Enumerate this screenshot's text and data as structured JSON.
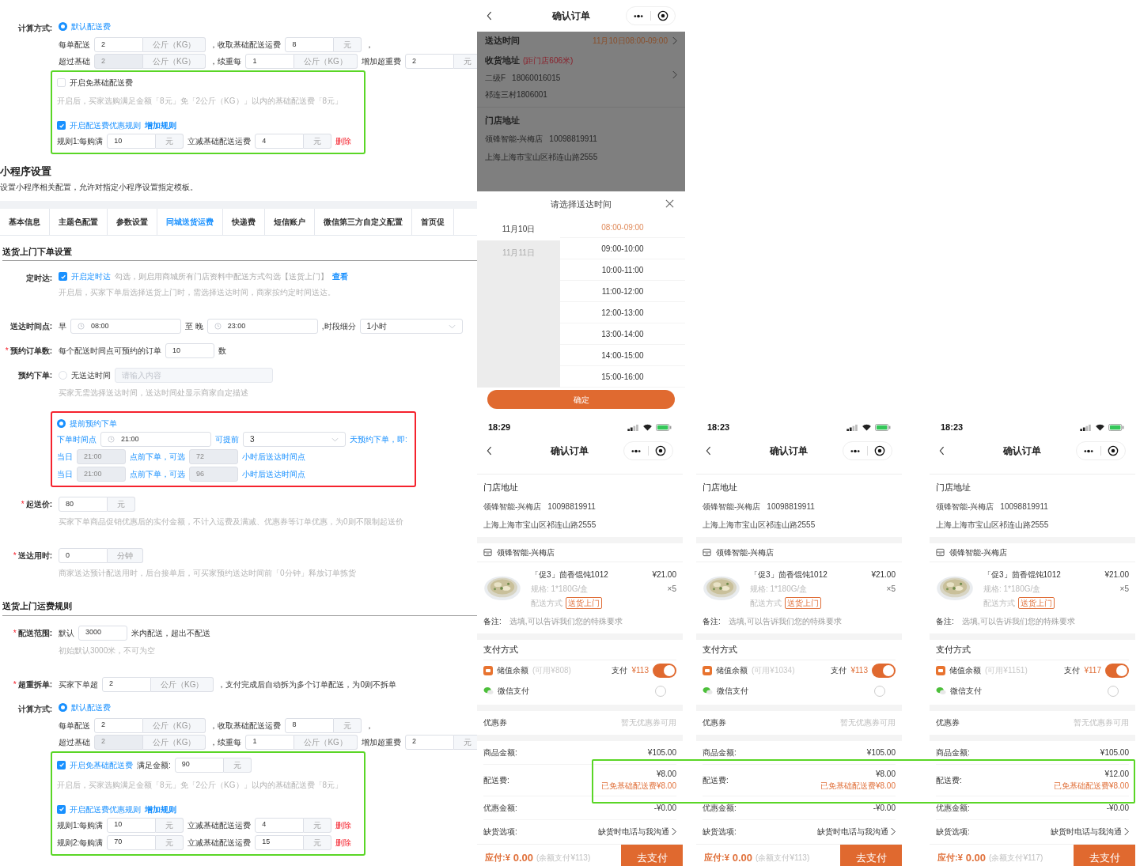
{
  "admin": {
    "blocks": [
      {
        "kind": "row",
        "label": "计算方式:",
        "parts": [
          {
            "kind": "radio",
            "label": "默认配送费",
            "selected": true
          }
        ]
      },
      {
        "kind": "subrow",
        "parts": [
          {
            "kind": "text",
            "text": "每单配送"
          },
          {
            "kind": "input",
            "value": "2",
            "addon": "公斤（KG）",
            "disabled": false
          },
          {
            "kind": "text",
            "text": "，收取基础配送运费"
          },
          {
            "kind": "input",
            "value": "8",
            "addon": "元",
            "disabled": false
          },
          {
            "kind": "text",
            "text": "，"
          }
        ]
      },
      {
        "kind": "subrow",
        "parts": [
          {
            "kind": "text",
            "text": "超过基础"
          },
          {
            "kind": "input",
            "value": "2",
            "addon": "公斤（KG）",
            "disabled": true
          },
          {
            "kind": "text",
            "text": "，续重每"
          },
          {
            "kind": "input",
            "value": "1",
            "addon": "公斤（KG）",
            "disabled": false
          },
          {
            "kind": "text",
            "text": "增加超重费"
          },
          {
            "kind": "input",
            "value": "2",
            "addon": "元",
            "disabled": false
          }
        ]
      },
      {
        "kind": "frame",
        "color": "#5ad626",
        "rows": [
          {
            "kind": "subrow",
            "parts": [
              {
                "kind": "checkbox",
                "label": "开启免基础配送费",
                "checked": false
              }
            ]
          },
          {
            "kind": "hint",
            "text": "开启后，买家选购满足金额「8元」免「2公斤（KG）」以内的基础配送费「8元」"
          },
          {
            "kind": "subrow",
            "parts": [
              {
                "kind": "checkbox",
                "label": "开启配送费优惠规则",
                "checked": true
              },
              {
                "kind": "link",
                "text": "增加规则"
              }
            ]
          },
          {
            "kind": "subrow",
            "parts": [
              {
                "kind": "text",
                "text": "规则1:每购满"
              },
              {
                "kind": "input",
                "value": "10",
                "addon": "元",
                "disabled": false
              },
              {
                "kind": "text",
                "text": "立减基础配送运费"
              },
              {
                "kind": "input",
                "value": "4",
                "addon": "元",
                "disabled": false
              },
              {
                "kind": "danger",
                "text": "删除"
              }
            ]
          }
        ]
      },
      {
        "kind": "page_title",
        "text": "小程序设置"
      },
      {
        "kind": "subtitle",
        "text": "设置小程序相关配置，允许对指定小程序设置指定模板。"
      },
      {
        "kind": "tabs",
        "tabs": [
          {
            "label": "基本信息",
            "selected": false
          },
          {
            "label": "主题色配置",
            "selected": false
          },
          {
            "label": "参数设置",
            "selected": false
          },
          {
            "label": "同城送货运费",
            "selected": true
          },
          {
            "label": "快递费",
            "selected": false
          },
          {
            "label": "短信账户",
            "selected": false
          },
          {
            "label": "微信第三方自定义配置",
            "selected": false
          },
          {
            "label": "首页促",
            "selected": false
          }
        ]
      },
      {
        "kind": "section",
        "text": "送货上门下单设置"
      },
      {
        "kind": "row",
        "label": "定时达:",
        "parts": [
          {
            "kind": "checkbox",
            "label": "开启定时达",
            "checked": true
          },
          {
            "kind": "muted",
            "text": "勾选，则启用商城所有门店资料中配送方式勾选【送货上门】"
          },
          {
            "kind": "link",
            "text": "查看"
          }
        ],
        "hint": "开启后，买家下单后选择送货上门时，需选择送达时间，商家按约定时间送达。"
      },
      {
        "kind": "row",
        "label": "送达时间点:",
        "parts": [
          {
            "kind": "text",
            "text": "早"
          },
          {
            "kind": "time",
            "value": "08:00"
          },
          {
            "kind": "text",
            "text": "至 晚"
          },
          {
            "kind": "time",
            "value": "23:00"
          },
          {
            "kind": "text",
            "text": ",时段细分"
          },
          {
            "kind": "select",
            "value": "1小时"
          }
        ]
      },
      {
        "kind": "row",
        "required_mark": "*",
        "label": "预约订单数:",
        "parts": [
          {
            "kind": "text",
            "text": "每个配送时间点可预约的订单"
          },
          {
            "kind": "input",
            "value": "10",
            "disabled": false
          },
          {
            "kind": "text",
            "text": "数"
          }
        ]
      },
      {
        "kind": "row",
        "label": "预约下单:",
        "parts": [
          {
            "kind": "radio",
            "label": "无送达时间",
            "selected": false
          },
          {
            "kind": "placeholder_input",
            "placeholder": "请输入内容"
          }
        ],
        "hint": "买家无需选择送达时间，送达时间处显示商家自定描述"
      },
      {
        "kind": "frame",
        "color": "#f5222d",
        "rows": [
          {
            "kind": "subrow",
            "parts": [
              {
                "kind": "radio",
                "label": "提前预约下单",
                "selected": true
              }
            ]
          },
          {
            "kind": "subrow",
            "parts": [
              {
                "kind": "accent",
                "text": "下单时间点"
              },
              {
                "kind": "time",
                "value": "21:00"
              },
              {
                "kind": "accent",
                "text": "可提前"
              },
              {
                "kind": "select",
                "value": "3"
              },
              {
                "kind": "accent",
                "text": "天预约下单，即:"
              }
            ]
          },
          {
            "kind": "subrow",
            "parts": [
              {
                "kind": "accent",
                "text": "当日"
              },
              {
                "kind": "input",
                "value": "21:00",
                "disabled": true
              },
              {
                "kind": "accent",
                "text": "点前下单，可选"
              },
              {
                "kind": "input",
                "value": "72",
                "disabled": true
              },
              {
                "kind": "accent",
                "text": "小时后送达时间点"
              }
            ]
          },
          {
            "kind": "subrow",
            "parts": [
              {
                "kind": "accent",
                "text": "当日"
              },
              {
                "kind": "input",
                "value": "21:00",
                "disabled": true
              },
              {
                "kind": "accent",
                "text": "点前下单，可选"
              },
              {
                "kind": "input",
                "value": "96",
                "disabled": true
              },
              {
                "kind": "accent",
                "text": "小时后送达时间点"
              }
            ]
          }
        ]
      },
      {
        "kind": "row",
        "required_mark": "*",
        "label": "起送价:",
        "parts": [
          {
            "kind": "input",
            "value": "80",
            "addon": "元",
            "disabled": false
          }
        ],
        "hint": "买家下单商品促销优惠后的实付金额，不计入运费及满减、优惠券等订单优惠，为0则不限制起送价"
      },
      {
        "kind": "row",
        "required_mark": "*",
        "label": "送达用时:",
        "parts": [
          {
            "kind": "input",
            "value": "0",
            "addon": "分钟",
            "disabled": false
          }
        ],
        "hint": "商家送达预计配送用时，后台接单后，可买家预约送达时间前「0分钟」释放订单拣货"
      },
      {
        "kind": "section",
        "text": "送货上门运费规则"
      },
      {
        "kind": "row",
        "required_mark": "*",
        "label": "配送范围:",
        "parts": [
          {
            "kind": "text",
            "text": "默认"
          },
          {
            "kind": "input",
            "value": "3000",
            "disabled": false
          },
          {
            "kind": "text",
            "text": "米内配送，超出不配送"
          }
        ],
        "hint": "初始默认3000米，不可为空"
      },
      {
        "kind": "row",
        "required_mark": "*",
        "label": "超重拆单:",
        "parts": [
          {
            "kind": "text",
            "text": "买家下单超"
          },
          {
            "kind": "input",
            "value": "2",
            "addon": "公斤（KG）",
            "disabled": false
          },
          {
            "kind": "text",
            "text": "，支付完成后自动拆为多个订单配送，为0则不拆单"
          }
        ]
      },
      {
        "kind": "row",
        "label": "计算方式:",
        "parts": [
          {
            "kind": "radio",
            "label": "默认配送费",
            "selected": true
          }
        ]
      },
      {
        "kind": "subrow",
        "parts": [
          {
            "kind": "text",
            "text": "每单配送"
          },
          {
            "kind": "input",
            "value": "2",
            "addon": "公斤（KG）",
            "disabled": false
          },
          {
            "kind": "text",
            "text": "，收取基础配送运费"
          },
          {
            "kind": "input",
            "value": "8",
            "addon": "元",
            "disabled": false
          },
          {
            "kind": "text",
            "text": "，"
          }
        ]
      },
      {
        "kind": "subrow",
        "parts": [
          {
            "kind": "text",
            "text": "超过基础"
          },
          {
            "kind": "input",
            "value": "2",
            "addon": "公斤（KG）",
            "disabled": true
          },
          {
            "kind": "text",
            "text": "，续重每"
          },
          {
            "kind": "input",
            "value": "1",
            "addon": "公斤（KG）",
            "disabled": false
          },
          {
            "kind": "text",
            "text": "增加超重费"
          },
          {
            "kind": "input",
            "value": "2",
            "addon": "元",
            "disabled": false
          }
        ]
      },
      {
        "kind": "frame",
        "color": "#5ad626",
        "rows": [
          {
            "kind": "subrow",
            "parts": [
              {
                "kind": "checkbox",
                "label": "开启免基础配送费",
                "checked": true
              },
              {
                "kind": "text",
                "text": "满足金额:"
              },
              {
                "kind": "input",
                "value": "90",
                "addon": "元",
                "disabled": false
              }
            ]
          },
          {
            "kind": "hint",
            "text": "开启后，买家选购满足金额「8元」免「2公斤（KG）」以内的基础配送费「8元」"
          },
          {
            "kind": "subrow",
            "parts": [
              {
                "kind": "checkbox",
                "label": "开启配送费优惠规则",
                "checked": true
              },
              {
                "kind": "link",
                "text": "增加规则"
              }
            ]
          },
          {
            "kind": "subrow",
            "parts": [
              {
                "kind": "text",
                "text": "规则1:每购满"
              },
              {
                "kind": "input",
                "value": "10",
                "addon": "元",
                "disabled": false
              },
              {
                "kind": "text",
                "text": "立减基础配送运费"
              },
              {
                "kind": "input",
                "value": "4",
                "addon": "元",
                "disabled": false
              },
              {
                "kind": "danger",
                "text": "删除"
              }
            ]
          },
          {
            "kind": "subrow",
            "parts": [
              {
                "kind": "text",
                "text": "规则2:每购满"
              },
              {
                "kind": "input",
                "value": "70",
                "addon": "元",
                "disabled": false
              },
              {
                "kind": "text",
                "text": "立减基础配送运费"
              },
              {
                "kind": "input",
                "value": "15",
                "addon": "元",
                "disabled": false
              },
              {
                "kind": "danger",
                "text": "删除"
              }
            ]
          }
        ]
      }
    ]
  },
  "modal_phone": {
    "title": "确认订单",
    "delivery_label": "送达时间",
    "delivery_value": "11月10日08:00-09:00",
    "address_label": "收货地址",
    "address_distance": "(距门店606米)",
    "address_name": "二级F",
    "address_phone": "18060016015",
    "address_line": "祁连三村1806001",
    "store_label": "门店地址",
    "store_name": "领锋智能-兴梅店",
    "store_phone": "10098819911",
    "store_address": "上海上海市宝山区祁连山路2555",
    "sheet": {
      "title": "请选择送达时间",
      "dates": [
        {
          "label": "11月10日",
          "selected": true
        },
        {
          "label": "11月11日",
          "selected": false
        }
      ],
      "slots": [
        {
          "label": "08:00-09:00",
          "selected": true
        },
        {
          "label": "09:00-10:00",
          "selected": false
        },
        {
          "label": "10:00-11:00",
          "selected": false
        },
        {
          "label": "11:00-12:00",
          "selected": false
        },
        {
          "label": "12:00-13:00",
          "selected": false
        },
        {
          "label": "13:00-14:00",
          "selected": false
        },
        {
          "label": "14:00-15:00",
          "selected": false
        },
        {
          "label": "15:00-16:00",
          "selected": false
        }
      ],
      "confirm": "确定"
    }
  },
  "order_phones": [
    {
      "time": "18:29",
      "title": "确认订单",
      "store_label": "门店地址",
      "store_name": "领锋智能-兴梅店",
      "store_phone": "10098819911",
      "store_address": "上海上海市宝山区祁连山路2555",
      "shop_name": "领锋智能-兴梅店",
      "product": {
        "name": "「促3」茴香馄饨1012",
        "price": "¥21.00",
        "spec": "规格: 1*180G/盒",
        "qty": "×5",
        "delivery_label": "配送方式",
        "delivery_tag": "送货上门"
      },
      "remark_label": "备注:",
      "remark_placeholder": "选填,可以告诉我们您的特殊要求",
      "payment_label": "支付方式",
      "methods": [
        {
          "kind": "balance",
          "label": "储值余额",
          "available": "(可用¥808)",
          "pay_label": "支付",
          "pay_amount": "¥113",
          "on": true
        },
        {
          "kind": "wechat",
          "label": "微信支付",
          "selected": false
        }
      ],
      "coupon_label": "优惠券",
      "coupon_value": "暂无优惠券可用",
      "summary": [
        {
          "label": "商品金额:",
          "value": "¥105.00"
        },
        {
          "label": "配送费:",
          "value": "¥8.00",
          "note": "已免基础配送费¥8.00"
        },
        {
          "label": "优惠金额:",
          "value": "-¥0.00"
        }
      ],
      "stock_label": "缺货选项:",
      "stock_value": "缺货时电话与我沟通",
      "due_label": "应付:¥",
      "due_amount": "0.00",
      "due_note": "(余额支付¥113)",
      "pay_button": "去支付"
    },
    {
      "time": "18:23",
      "title": "确认订单",
      "store_label": "门店地址",
      "store_name": "领锋智能-兴梅店",
      "store_phone": "10098819911",
      "store_address": "上海上海市宝山区祁连山路2555",
      "shop_name": "领锋智能-兴梅店",
      "product": {
        "name": "「促3」茴香馄饨1012",
        "price": "¥21.00",
        "spec": "规格: 1*180G/盒",
        "qty": "×5",
        "delivery_label": "配送方式",
        "delivery_tag": "送货上门"
      },
      "remark_label": "备注:",
      "remark_placeholder": "选填,可以告诉我们您的特殊要求",
      "payment_label": "支付方式",
      "methods": [
        {
          "kind": "balance",
          "label": "储值余额",
          "available": "(可用¥1034)",
          "pay_label": "支付",
          "pay_amount": "¥113",
          "on": true
        },
        {
          "kind": "wechat",
          "label": "微信支付",
          "selected": false
        }
      ],
      "coupon_label": "优惠券",
      "coupon_value": "暂无优惠券可用",
      "summary": [
        {
          "label": "商品金额:",
          "value": "¥105.00"
        },
        {
          "label": "配送费:",
          "value": "¥8.00",
          "note": "已免基础配送费¥8.00"
        },
        {
          "label": "优惠金额:",
          "value": "-¥0.00"
        }
      ],
      "stock_label": "缺货选项:",
      "stock_value": "缺货时电话与我沟通",
      "due_label": "应付:¥",
      "due_amount": "0.00",
      "due_note": "(余额支付¥113)",
      "pay_button": "去支付"
    },
    {
      "time": "18:23",
      "title": "确认订单",
      "store_label": "门店地址",
      "store_name": "领锋智能-兴梅店",
      "store_phone": "10098819911",
      "store_address": "上海上海市宝山区祁连山路2555",
      "shop_name": "领锋智能-兴梅店",
      "product": {
        "name": "「促3」茴香馄饨1012",
        "price": "¥21.00",
        "spec": "规格: 1*180G/盒",
        "qty": "×5",
        "delivery_label": "配送方式",
        "delivery_tag": "送货上门"
      },
      "remark_label": "备注:",
      "remark_placeholder": "选填,可以告诉我们您的特殊要求",
      "payment_label": "支付方式",
      "methods": [
        {
          "kind": "balance",
          "label": "储值余额",
          "available": "(可用¥1151)",
          "pay_label": "支付",
          "pay_amount": "¥117",
          "on": true
        },
        {
          "kind": "wechat",
          "label": "微信支付",
          "selected": false
        }
      ],
      "coupon_label": "优惠券",
      "coupon_value": "暂无优惠券可用",
      "summary": [
        {
          "label": "商品金额:",
          "value": "¥105.00"
        },
        {
          "label": "配送费:",
          "value": "¥12.00",
          "note": "已免基础配送费¥8.00"
        },
        {
          "label": "优惠金额:",
          "value": "-¥0.00"
        }
      ],
      "stock_label": "缺货选项:",
      "stock_value": "缺货时电话与我沟通",
      "due_label": "应付:¥",
      "due_amount": "0.00",
      "due_note": "(余额支付¥117)",
      "pay_button": "去支付"
    }
  ],
  "overlay_frame": {
    "color": "#5ad626"
  }
}
